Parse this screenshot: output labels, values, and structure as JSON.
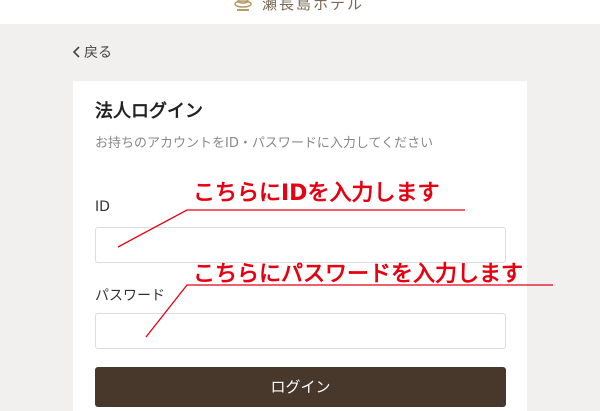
{
  "header": {
    "brand_name": "瀬長島ホテル"
  },
  "nav": {
    "back_label": "戻る"
  },
  "login_card": {
    "title": "法人ログイン",
    "description": "お持ちのアカウントをID・パスワードに入力してください",
    "id_label": "ID",
    "id_value": "",
    "password_label": "パスワード",
    "password_value": "",
    "submit_label": "ログイン"
  },
  "annotations": {
    "id_note": "こちらにIDを入力します",
    "password_note": "こちらにパスワードを入力します"
  },
  "colors": {
    "annotation": "#e60012",
    "button": "#47382b",
    "brand": "#7a6a55"
  }
}
